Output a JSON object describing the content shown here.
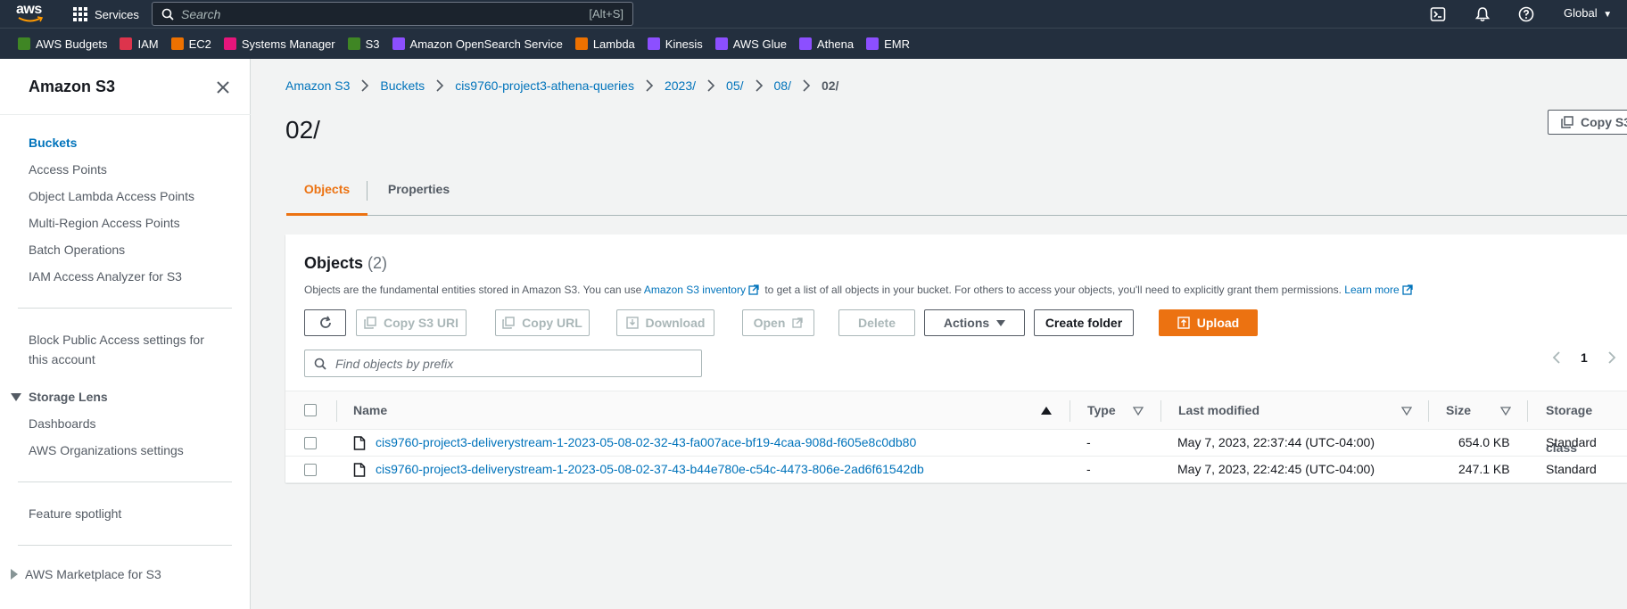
{
  "topnav": {
    "logo_text": "aws",
    "services_label": "Services",
    "search_placeholder": "Search",
    "search_shortcut": "[Alt+S]",
    "region_label": "Global"
  },
  "favorites": [
    {
      "label": "AWS Budgets",
      "color": "#3f8624"
    },
    {
      "label": "IAM",
      "color": "#dd344c"
    },
    {
      "label": "EC2",
      "color": "#ed7100"
    },
    {
      "label": "Systems Manager",
      "color": "#e7157b"
    },
    {
      "label": "S3",
      "color": "#3f8624"
    },
    {
      "label": "Amazon OpenSearch Service",
      "color": "#8c4fff"
    },
    {
      "label": "Lambda",
      "color": "#ed7100"
    },
    {
      "label": "Kinesis",
      "color": "#8c4fff"
    },
    {
      "label": "AWS Glue",
      "color": "#8c4fff"
    },
    {
      "label": "Athena",
      "color": "#8c4fff"
    },
    {
      "label": "EMR",
      "color": "#8c4fff"
    }
  ],
  "sidebar": {
    "title": "Amazon S3",
    "items": [
      {
        "label": "Buckets",
        "active": true
      },
      {
        "label": "Access Points"
      },
      {
        "label": "Object Lambda Access Points"
      },
      {
        "label": "Multi-Region Access Points"
      },
      {
        "label": "Batch Operations"
      },
      {
        "label": "IAM Access Analyzer for S3"
      }
    ],
    "block_public_line1": "Block Public Access settings for",
    "block_public_line2": "this account",
    "storage_lens": {
      "label": "Storage Lens",
      "items": [
        "Dashboards",
        "AWS Organizations settings"
      ]
    },
    "feature_spotlight": "Feature spotlight",
    "marketplace": "AWS Marketplace for S3"
  },
  "breadcrumb": [
    "Amazon S3",
    "Buckets",
    "cis9760-project3-athena-queries",
    "2023/",
    "05/",
    "08/",
    "02/"
  ],
  "page_title": "02/",
  "copy_s3_uri_top": "Copy S3",
  "tabs": [
    {
      "label": "Objects",
      "active": true
    },
    {
      "label": "Properties"
    }
  ],
  "objects_panel": {
    "title": "Objects",
    "count": "(2)",
    "desc_prefix": "Objects are the fundamental entities stored in Amazon S3. You can use",
    "desc_link1": "Amazon S3 inventory",
    "desc_middle": "to get a list of all objects in your bucket. For others to access your objects, you'll need to explicitly grant them permissions.",
    "desc_link2": "Learn more",
    "buttons": {
      "copy_s3_uri": "Copy S3 URI",
      "copy_url": "Copy URL",
      "download": "Download",
      "open": "Open",
      "delete": "Delete",
      "actions": "Actions",
      "create_folder": "Create folder",
      "upload": "Upload"
    },
    "find_placeholder": "Find objects by prefix",
    "page_number": "1",
    "columns": {
      "name": "Name",
      "type": "Type",
      "last_modified": "Last modified",
      "size": "Size",
      "storage_class": "Storage class"
    },
    "rows": [
      {
        "name": "cis9760-project3-deliverystream-1-2023-05-08-02-32-43-fa007ace-bf19-4caa-908d-f605e8c0db80",
        "type": "-",
        "last_modified": "May 7, 2023, 22:37:44 (UTC-04:00)",
        "size": "654.0 KB",
        "storage_class": "Standard"
      },
      {
        "name": "cis9760-project3-deliverystream-1-2023-05-08-02-37-43-b44e780e-c54c-4473-806e-2ad6f61542db",
        "type": "-",
        "last_modified": "May 7, 2023, 22:42:45 (UTC-04:00)",
        "size": "247.1 KB",
        "storage_class": "Standard"
      }
    ]
  }
}
